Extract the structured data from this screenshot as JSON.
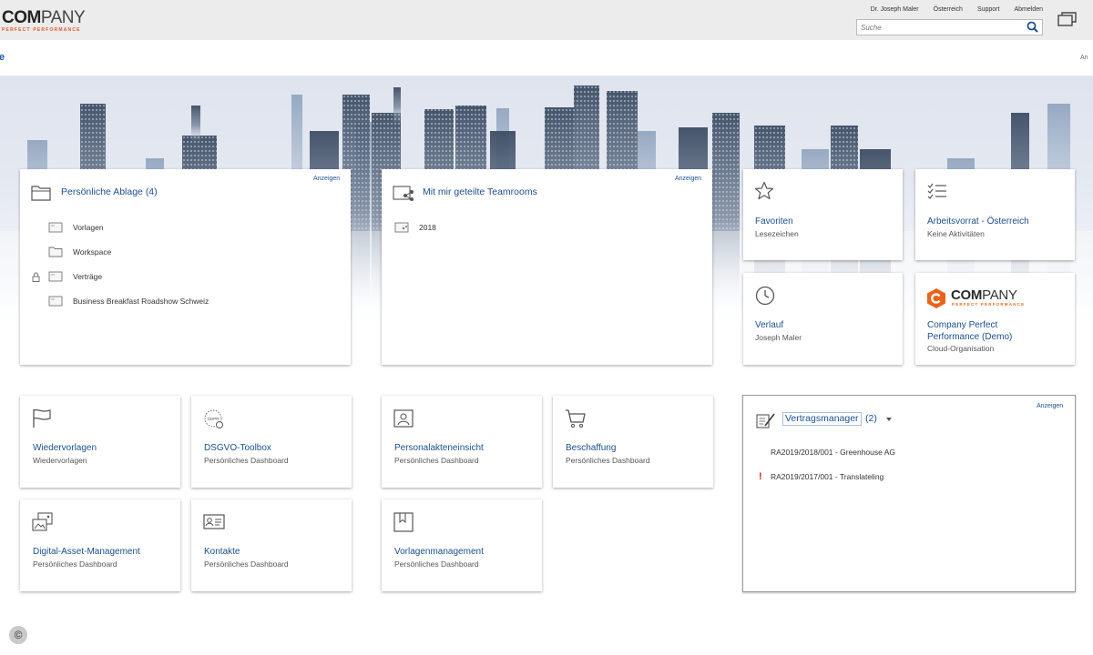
{
  "header": {
    "logo_main": "COMPANY",
    "logo_bold": "COM",
    "logo_rest": "PANY",
    "logo_tagline": "PERFECT PERFORMANCE",
    "links": [
      "Dr. Joseph Maler",
      "Österreich",
      "Support",
      "Abmelden"
    ],
    "search_placeholder": "Suche"
  },
  "subbar": {
    "left_text": "e",
    "right_text": "An"
  },
  "ablage": {
    "title": "Persönliche Ablage (4)",
    "action": "Anzeigen",
    "items": [
      {
        "label": "Vorlagen",
        "icon": "folder-doc-icon",
        "locked": false
      },
      {
        "label": "Workspace",
        "icon": "folder-icon",
        "locked": false
      },
      {
        "label": "Verträge",
        "icon": "folder-doc-icon",
        "locked": true
      },
      {
        "label": "Business Breakfast Roadshow Schweiz",
        "icon": "folder-doc-icon",
        "locked": false
      }
    ]
  },
  "teamrooms": {
    "title": "Mit mir geteilte Teamrooms",
    "action": "Anzeigen",
    "items": [
      {
        "label": "2018",
        "icon": "shared-room-icon"
      }
    ]
  },
  "favoriten": {
    "title": "Favoriten",
    "sub": "Lesezeichen"
  },
  "arbeitsvorrat": {
    "title": "Arbeitsvorrat - Österreich",
    "sub": "Keine Aktivitäten"
  },
  "verlauf": {
    "title": "Verlauf",
    "sub": "Joseph Maler"
  },
  "company_card": {
    "logo_bold": "COM",
    "logo_rest": "PANY",
    "logo_tagline": "PERFECT PERFORMANCE",
    "title_line1": "Company Perfect",
    "title_line2": "Performance (Demo)",
    "sub": "Cloud-Organisation"
  },
  "tiles": [
    {
      "title": "Wiedervorlagen",
      "sub": "Wiedervorlagen",
      "icon": "flag-icon"
    },
    {
      "title": "DSGVO-Toolbox",
      "sub": "Persönliches Dashboard",
      "icon": "gdpr-icon"
    },
    {
      "title": "Personalakteneinsicht",
      "sub": "Persönliches Dashboard",
      "icon": "person-file-icon"
    },
    {
      "title": "Beschaffung",
      "sub": "Persönliches Dashboard",
      "icon": "cart-icon"
    },
    {
      "title": "Digital-Asset-Management",
      "sub": "Persönliches Dashboard",
      "icon": "images-icon"
    },
    {
      "title": "Kontakte",
      "sub": "Persönliches Dashboard",
      "icon": "contact-card-icon"
    },
    {
      "title": "Vorlagenmanagement",
      "sub": "Persönliches Dashboard",
      "icon": "template-book-icon"
    }
  ],
  "vertragsmanager": {
    "title": "Vertragsmanager",
    "count": "(2)",
    "action": "Anzeigen",
    "items": [
      {
        "label": "RA2019/2018/001 - Greenhouse AG",
        "flag": ""
      },
      {
        "label": "RA2019/2017/001 - Translateling",
        "flag": "!"
      }
    ]
  },
  "footer": {
    "copyright": "©"
  },
  "colors": {
    "link": "#1a4f8f",
    "brand_orange": "#e8641c",
    "topbar": "#ececec"
  }
}
